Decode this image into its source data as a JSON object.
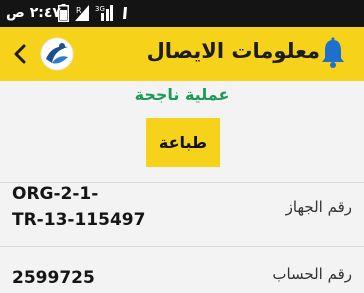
{
  "status_bar": {
    "time": "٢:٤٧ ص",
    "icons": [
      "battery-icon",
      "notification-icon",
      "signal-icon",
      "warning-icon"
    ]
  },
  "header": {
    "title": "معلومات الايصال",
    "icons": [
      "back-icon",
      "logo-icon",
      "bell-icon"
    ]
  },
  "result": {
    "message": "عملية ناجحة",
    "print_label": "طباعة"
  },
  "details": [
    {
      "label": "رقم الجهاز",
      "value_lines": [
        "ORG-2-1-",
        "TR-13-115497"
      ]
    },
    {
      "label": "رقم الحساب",
      "value_lines": [
        "2599725"
      ]
    }
  ],
  "colors": {
    "accent": "#f6d21a",
    "success": "#1e9a57",
    "status_bar": "#141414",
    "background": "#f3f3f3"
  }
}
